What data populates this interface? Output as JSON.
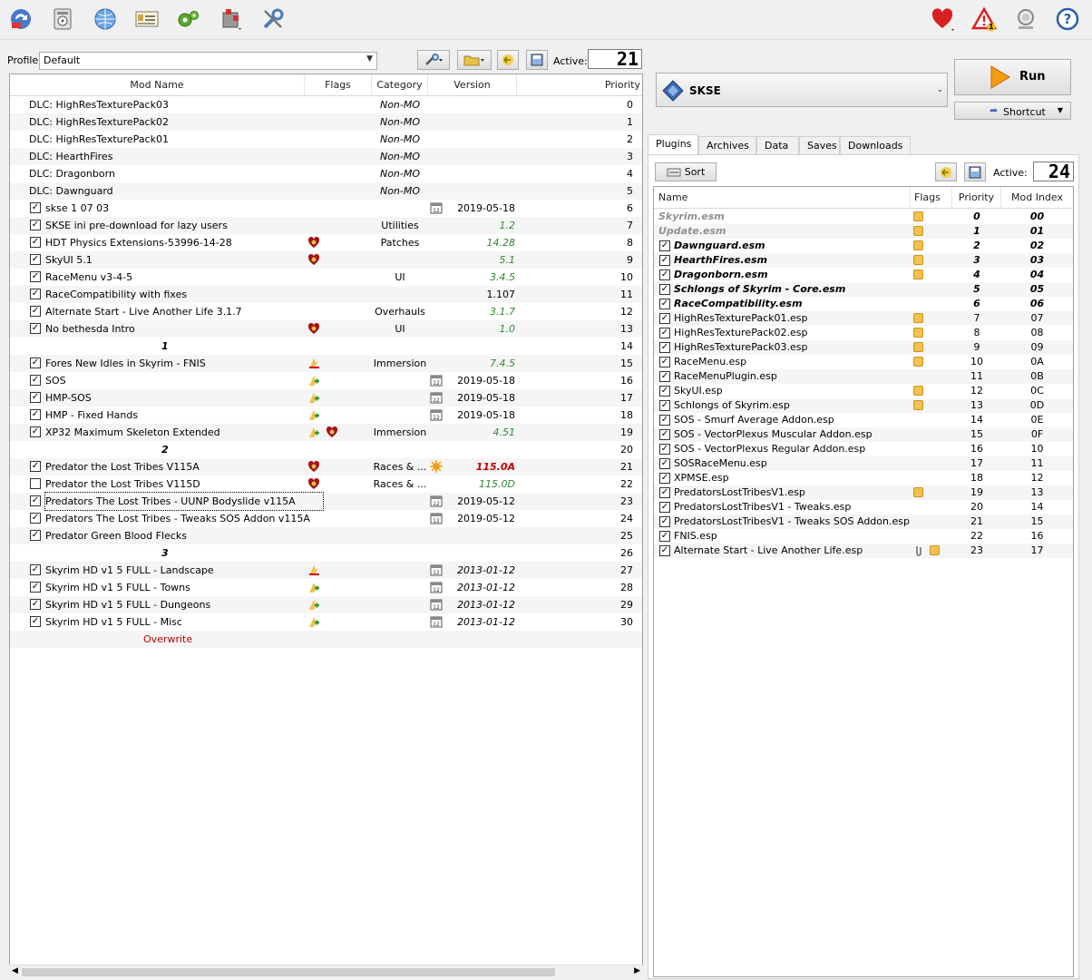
{
  "toolbar": {
    "left_icons": [
      "change-instance-icon",
      "archive-icon",
      "browser-icon",
      "executables-icon",
      "settings-gear-icon",
      "tools-puzzle-icon",
      "wrench-icon"
    ],
    "right_icons": [
      "endorse-heart-icon",
      "warning-icon",
      "update-icon",
      "help-icon"
    ],
    "warning_count": "1"
  },
  "profile": {
    "label": "Profile",
    "value": "Default",
    "active_label": "Active:",
    "active_count": "21"
  },
  "mod_list": {
    "columns": [
      "Mod Name",
      "Flags",
      "Category",
      "Version",
      "Priority"
    ],
    "rows": [
      {
        "name": "DLC: HighResTexturePack03",
        "checkbox": null,
        "flags": [],
        "category": "Non-MO",
        "version": "",
        "version_style": "",
        "priority": "0",
        "cat_style": "it"
      },
      {
        "name": "DLC: HighResTexturePack02",
        "checkbox": null,
        "flags": [],
        "category": "Non-MO",
        "version": "",
        "version_style": "",
        "priority": "1",
        "cat_style": "it"
      },
      {
        "name": "DLC: HighResTexturePack01",
        "checkbox": null,
        "flags": [],
        "category": "Non-MO",
        "version": "",
        "version_style": "",
        "priority": "2",
        "cat_style": "it"
      },
      {
        "name": "DLC: HearthFires",
        "checkbox": null,
        "flags": [],
        "category": "Non-MO",
        "version": "",
        "version_style": "",
        "priority": "3",
        "cat_style": "it"
      },
      {
        "name": "DLC: Dragonborn",
        "checkbox": null,
        "flags": [],
        "category": "Non-MO",
        "version": "",
        "version_style": "",
        "priority": "4",
        "cat_style": "it"
      },
      {
        "name": "DLC: Dawnguard",
        "checkbox": null,
        "flags": [],
        "category": "Non-MO",
        "version": "",
        "version_style": "",
        "priority": "5",
        "cat_style": "it"
      },
      {
        "name": "skse 1 07 03",
        "checkbox": true,
        "flags": [],
        "category": "",
        "cal": true,
        "version": "2019-05-18",
        "version_style": "",
        "priority": "6"
      },
      {
        "name": "SKSE ini pre-download for lazy users",
        "checkbox": true,
        "flags": [],
        "category": "Utilities",
        "version": "1.2",
        "version_style": "green it",
        "priority": "7"
      },
      {
        "name": "HDT Physics Extensions-53996-14-28",
        "checkbox": true,
        "flags": [
          "heart"
        ],
        "category": "Patches",
        "version": "14.28",
        "version_style": "green it",
        "priority": "8"
      },
      {
        "name": "SkyUI 5.1",
        "checkbox": true,
        "flags": [
          "heart"
        ],
        "category": "",
        "version": "5.1",
        "version_style": "green it",
        "priority": "9"
      },
      {
        "name": "RaceMenu v3-4-5",
        "checkbox": true,
        "flags": [],
        "category": "UI",
        "version": "3.4.5",
        "version_style": "green it",
        "priority": "10"
      },
      {
        "name": "RaceCompatibility with fixes",
        "checkbox": true,
        "flags": [],
        "category": "",
        "version": "1.107",
        "version_style": "",
        "priority": "11"
      },
      {
        "name": "Alternate Start - Live Another Life 3.1.7",
        "checkbox": true,
        "flags": [],
        "category": "Overhauls",
        "version": "3.1.7",
        "version_style": "green it",
        "priority": "12"
      },
      {
        "name": "No bethesda Intro",
        "checkbox": true,
        "flags": [
          "heart"
        ],
        "category": "UI",
        "version": "1.0",
        "version_style": "green it",
        "priority": "13"
      },
      {
        "name": "1",
        "separator": true,
        "priority": "14"
      },
      {
        "name": "Fores New Idles in Skyrim - FNIS",
        "checkbox": true,
        "flags": [
          "conflict-red"
        ],
        "category": "Immersion",
        "version": "7.4.5",
        "version_style": "green it",
        "priority": "15"
      },
      {
        "name": "SOS",
        "checkbox": true,
        "flags": [
          "conflict-green"
        ],
        "category": "",
        "cal": true,
        "version": "2019-05-18",
        "version_style": "",
        "priority": "16"
      },
      {
        "name": "HMP-SOS",
        "checkbox": true,
        "flags": [
          "conflict-green"
        ],
        "category": "",
        "cal": true,
        "version": "2019-05-18",
        "version_style": "",
        "priority": "17"
      },
      {
        "name": "HMP - Fixed Hands",
        "checkbox": true,
        "flags": [
          "conflict-green"
        ],
        "category": "",
        "cal": true,
        "version": "2019-05-18",
        "version_style": "",
        "priority": "18"
      },
      {
        "name": "XP32 Maximum Skeleton Extended",
        "checkbox": true,
        "flags": [
          "conflict-green",
          "heart"
        ],
        "category": "Immersion",
        "version": "4.51",
        "version_style": "green it",
        "priority": "19"
      },
      {
        "name": "2",
        "separator": true,
        "priority": "20"
      },
      {
        "name": "Predator the Lost Tribes V115A",
        "checkbox": true,
        "flags": [
          "heart"
        ],
        "category": "Races & ...",
        "sun": true,
        "version": "115.0A",
        "version_style": "red it",
        "priority": "21"
      },
      {
        "name": "Predator the Lost Tribes V115D",
        "checkbox": false,
        "flags": [
          "heart"
        ],
        "category": "Races & ...",
        "version": "115.0D",
        "version_style": "green it",
        "priority": "22"
      },
      {
        "name": "Predators The Lost Tribes - UUNP Bodyslide v115A",
        "checkbox": true,
        "flags": [],
        "category": "",
        "cal": true,
        "version": "2019-05-12",
        "version_style": "",
        "priority": "23",
        "focus": true
      },
      {
        "name": "Predators The Lost Tribes - Tweaks SOS Addon v115A",
        "checkbox": true,
        "flags": [],
        "category": "",
        "cal": true,
        "version": "2019-05-12",
        "version_style": "",
        "priority": "24"
      },
      {
        "name": "Predator Green Blood Flecks",
        "checkbox": true,
        "flags": [],
        "category": "",
        "version": "",
        "version_style": "",
        "priority": "25"
      },
      {
        "name": "3",
        "separator": true,
        "priority": "26"
      },
      {
        "name": "Skyrim HD v1 5 FULL - Landscape",
        "checkbox": true,
        "flags": [
          "conflict-red"
        ],
        "category": "",
        "cal": true,
        "version": "2013-01-12",
        "version_style": "it",
        "priority": "27"
      },
      {
        "name": "Skyrim HD v1 5 FULL - Towns",
        "checkbox": true,
        "flags": [
          "conflict-green"
        ],
        "category": "",
        "cal": true,
        "version": "2013-01-12",
        "version_style": "it",
        "priority": "28"
      },
      {
        "name": "Skyrim HD v1 5 FULL - Dungeons",
        "checkbox": true,
        "flags": [
          "conflict-green"
        ],
        "category": "",
        "cal": true,
        "version": "2013-01-12",
        "version_style": "it",
        "priority": "29"
      },
      {
        "name": "Skyrim HD v1 5 FULL - Misc",
        "checkbox": true,
        "flags": [
          "conflict-green"
        ],
        "category": "",
        "cal": true,
        "version": "2013-01-12",
        "version_style": "it",
        "priority": "30"
      },
      {
        "name": "Overwrite",
        "overwrite": true
      }
    ]
  },
  "executable": {
    "name": "SKSE",
    "run_label": "Run",
    "shortcut_label": "Shortcut"
  },
  "tabs": [
    "Plugins",
    "Archives",
    "Data",
    "Saves",
    "Downloads"
  ],
  "plugins": {
    "sort_label": "Sort",
    "active_label": "Active:",
    "active_count": "24",
    "columns": [
      "Name",
      "Flags",
      "Priority",
      "Mod Index"
    ],
    "rows": [
      {
        "name": "Skyrim.esm",
        "style": "gray it b",
        "flags": [
          "box"
        ],
        "priority": "0",
        "index": "00",
        "checkbox": null
      },
      {
        "name": "Update.esm",
        "style": "gray it b",
        "flags": [
          "box"
        ],
        "priority": "1",
        "index": "01",
        "checkbox": null
      },
      {
        "name": "Dawnguard.esm",
        "style": "it b",
        "flags": [
          "box"
        ],
        "priority": "2",
        "index": "02",
        "checkbox": true
      },
      {
        "name": "HearthFires.esm",
        "style": "it b",
        "flags": [
          "box"
        ],
        "priority": "3",
        "index": "03",
        "checkbox": true
      },
      {
        "name": "Dragonborn.esm",
        "style": "it b",
        "flags": [
          "box"
        ],
        "priority": "4",
        "index": "04",
        "checkbox": true
      },
      {
        "name": "Schlongs of Skyrim - Core.esm",
        "style": "it b",
        "flags": [],
        "priority": "5",
        "index": "05",
        "checkbox": true
      },
      {
        "name": "RaceCompatibility.esm",
        "style": "it b",
        "flags": [],
        "priority": "6",
        "index": "06",
        "checkbox": true
      },
      {
        "name": "HighResTexturePack01.esp",
        "style": "",
        "flags": [
          "box"
        ],
        "priority": "7",
        "index": "07",
        "checkbox": true
      },
      {
        "name": "HighResTexturePack02.esp",
        "style": "",
        "flags": [
          "box"
        ],
        "priority": "8",
        "index": "08",
        "checkbox": true
      },
      {
        "name": "HighResTexturePack03.esp",
        "style": "",
        "flags": [
          "box"
        ],
        "priority": "9",
        "index": "09",
        "checkbox": true
      },
      {
        "name": "RaceMenu.esp",
        "style": "",
        "flags": [
          "box"
        ],
        "priority": "10",
        "index": "0A",
        "checkbox": true
      },
      {
        "name": "RaceMenuPlugin.esp",
        "style": "",
        "flags": [],
        "priority": "11",
        "index": "0B",
        "checkbox": true
      },
      {
        "name": "SkyUI.esp",
        "style": "",
        "flags": [
          "box"
        ],
        "priority": "12",
        "index": "0C",
        "checkbox": true
      },
      {
        "name": "Schlongs of Skyrim.esp",
        "style": "",
        "flags": [
          "box"
        ],
        "priority": "13",
        "index": "0D",
        "checkbox": true
      },
      {
        "name": "SOS - Smurf Average Addon.esp",
        "style": "",
        "flags": [],
        "priority": "14",
        "index": "0E",
        "checkbox": true
      },
      {
        "name": "SOS - VectorPlexus Muscular Addon.esp",
        "style": "",
        "flags": [],
        "priority": "15",
        "index": "0F",
        "checkbox": true
      },
      {
        "name": "SOS - VectorPlexus Regular Addon.esp",
        "style": "",
        "flags": [],
        "priority": "16",
        "index": "10",
        "checkbox": true
      },
      {
        "name": "SOSRaceMenu.esp",
        "style": "",
        "flags": [],
        "priority": "17",
        "index": "11",
        "checkbox": true
      },
      {
        "name": "XPMSE.esp",
        "style": "",
        "flags": [],
        "priority": "18",
        "index": "12",
        "checkbox": true
      },
      {
        "name": "PredatorsLostTribesV1.esp",
        "style": "",
        "flags": [
          "box"
        ],
        "priority": "19",
        "index": "13",
        "checkbox": true
      },
      {
        "name": "PredatorsLostTribesV1 - Tweaks.esp",
        "style": "",
        "flags": [],
        "priority": "20",
        "index": "14",
        "checkbox": true
      },
      {
        "name": "PredatorsLostTribesV1 - Tweaks SOS Addon.esp",
        "style": "",
        "flags": [],
        "priority": "21",
        "index": "15",
        "checkbox": true
      },
      {
        "name": "FNIS.esp",
        "style": "",
        "flags": [],
        "priority": "22",
        "index": "16",
        "checkbox": true
      },
      {
        "name": "Alternate Start - Live Another Life.esp",
        "style": "",
        "flags": [
          "clip",
          "box"
        ],
        "priority": "23",
        "index": "17",
        "checkbox": true
      }
    ]
  }
}
